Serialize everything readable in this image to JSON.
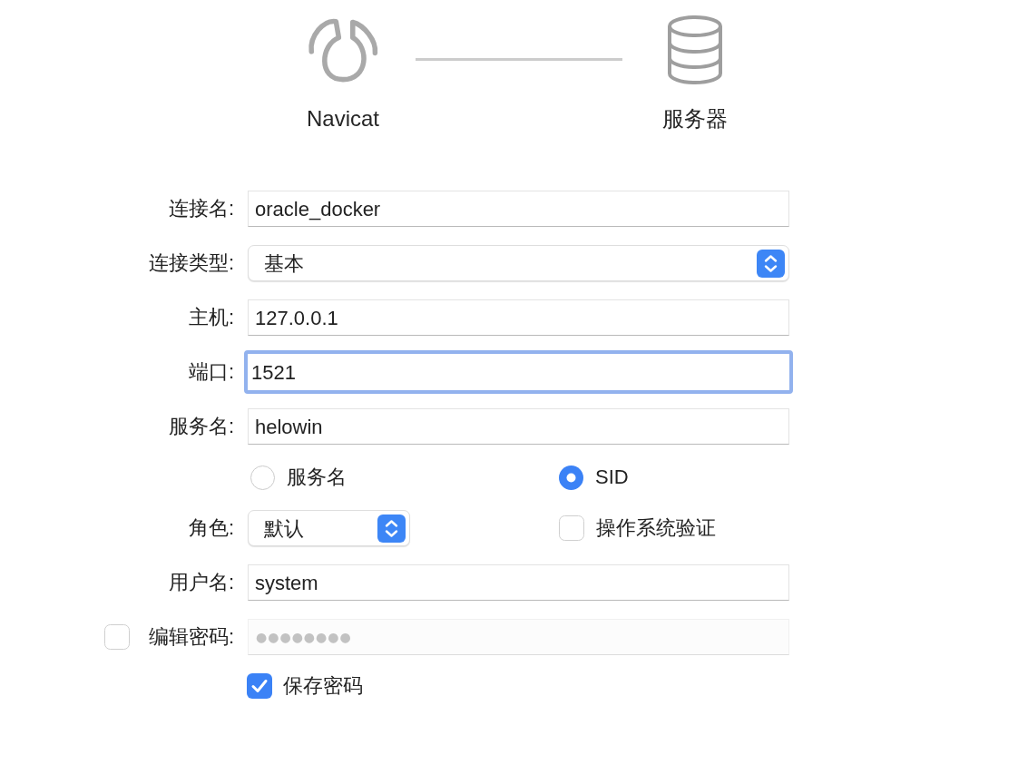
{
  "header": {
    "steps": [
      {
        "kind": "app",
        "label": "Navicat"
      },
      {
        "kind": "server",
        "label": "服务器"
      }
    ]
  },
  "form": {
    "rows": [
      {
        "kind": "text",
        "label": "连接名:",
        "value": "oracle_docker",
        "focused": false
      },
      {
        "kind": "select",
        "label": "连接类型:",
        "value": "基本"
      },
      {
        "kind": "text",
        "label": "主机:",
        "value": "127.0.0.1",
        "focused": false
      },
      {
        "kind": "text",
        "label": "端口:",
        "value": "1521",
        "focused": true
      },
      {
        "kind": "text",
        "label": "服务名:",
        "value": "helowin",
        "focused": false
      },
      {
        "kind": "radio",
        "options": [
          {
            "label": "服务名",
            "selected": false
          },
          {
            "label": "SID",
            "selected": true
          }
        ]
      },
      {
        "kind": "select_check",
        "label": "角色:",
        "value": "默认",
        "check": {
          "label": "操作系统验证",
          "checked": false
        }
      },
      {
        "kind": "text",
        "label": "用户名:",
        "value": "system",
        "focused": false
      },
      {
        "kind": "password",
        "checked": false,
        "label": "编辑密码:",
        "value": "●●●●●●●●",
        "disabled": true
      },
      {
        "kind": "checkbox",
        "label": "保存密码",
        "checked": true
      }
    ]
  }
}
